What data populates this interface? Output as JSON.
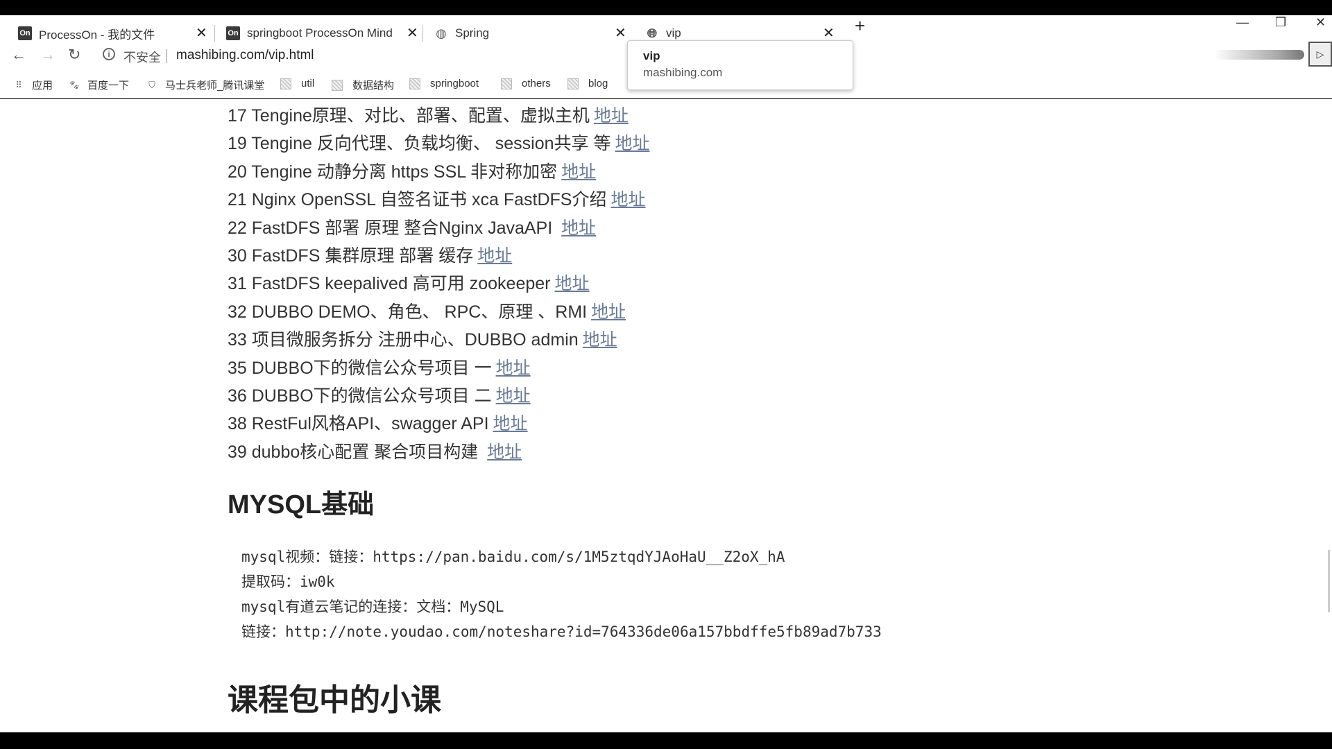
{
  "tabs": [
    {
      "title": "ProcessOn - 我的文件",
      "favicon": "On"
    },
    {
      "title": "springboot ProcessOn Mind",
      "favicon": "On"
    },
    {
      "title": "Spring",
      "favicon": "spring-icon"
    },
    {
      "title": "vip",
      "favicon": "globe-icon"
    }
  ],
  "address": {
    "security": "不安全",
    "url": "mashibing.com/vip.html"
  },
  "bookmarks": [
    "应用",
    "百度一下",
    "马士兵老师_腾讯课堂",
    "util",
    "数据结构",
    "springboot",
    "others",
    "blog"
  ],
  "tooltip": {
    "title": "vip",
    "url": "mashibing.com"
  },
  "courses": [
    {
      "text": "17 Tengine原理、对比、部署、配置、虚拟主机",
      "link": "地址"
    },
    {
      "text": "19 Tengine 反向代理、负载均衡、 session共享 等",
      "link": "地址"
    },
    {
      "text": "20  Tengine 动静分离 https SSL 非对称加密",
      "link": "地址"
    },
    {
      "text": "21 Nginx OpenSSL 自签名证书 xca FastDFS介绍",
      "link": "地址"
    },
    {
      "text": "22 FastDFS 部署 原理  整合Nginx JavaAPI ",
      "link": "地址"
    },
    {
      "text": "30 FastDFS 集群原理 部署 缓存",
      "link": "地址"
    },
    {
      "text": "31 FastDFS keepalived 高可用 zookeeper",
      "link": "地址"
    },
    {
      "text": "32 DUBBO DEMO、角色、 RPC、原理 、RMI",
      "link": "地址"
    },
    {
      "text": "33 项目微服务拆分 注册中心、DUBBO admin",
      "link": "地址"
    },
    {
      "text": "35 DUBBO下的微信公众号项目 一",
      "link": "地址"
    },
    {
      "text": "36 DUBBO下的微信公众号项目 二",
      "link": "地址"
    },
    {
      "text": "38 RestFul风格API、swagger API",
      "link": "地址"
    },
    {
      "text": "39 dubbo核心配置 聚合项目构建 ",
      "link": "地址"
    }
  ],
  "mysql": {
    "heading": "MYSQL基础",
    "lines": [
      "mysql视频：链接：https://pan.baidu.com/s/1M5ztqdYJAoHaU__Z2oX_hA",
      "提取码：iw0k",
      "mysql有道云笔记的连接：文档：MySQL",
      "链接：http://note.youdao.com/noteshare?id=764336de06a157bbdffe5fb89ad7b733"
    ]
  },
  "next_heading": "课程包中的小课"
}
